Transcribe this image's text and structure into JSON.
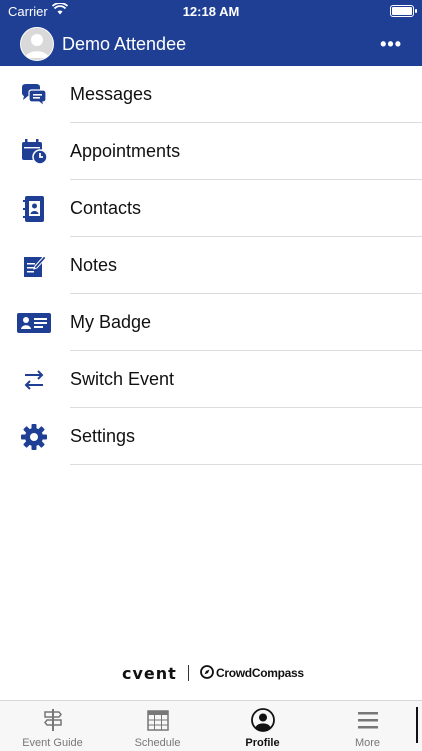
{
  "status_bar": {
    "carrier": "Carrier",
    "time": "12:18 AM"
  },
  "header": {
    "user_name": "Demo Attendee",
    "more_label": "•••"
  },
  "menu": [
    {
      "label": "Messages",
      "icon": "chat-icon"
    },
    {
      "label": "Appointments",
      "icon": "calendar-clock-icon"
    },
    {
      "label": "Contacts",
      "icon": "contact-book-icon"
    },
    {
      "label": "Notes",
      "icon": "note-edit-icon"
    },
    {
      "label": "My Badge",
      "icon": "badge-icon"
    },
    {
      "label": "Switch Event",
      "icon": "switch-arrows-icon"
    },
    {
      "label": "Settings",
      "icon": "gear-icon"
    }
  ],
  "brand": {
    "cvent": "cvent",
    "partner": "CrowdCompass"
  },
  "tabs": [
    {
      "label": "Event Guide",
      "icon": "signpost-icon",
      "active": false
    },
    {
      "label": "Schedule",
      "icon": "calendar-grid-icon",
      "active": false
    },
    {
      "label": "Profile",
      "icon": "profile-icon",
      "active": true
    },
    {
      "label": "More",
      "icon": "menu-icon",
      "active": false
    }
  ],
  "colors": {
    "primary": "#1f3f95",
    "tab_bar_bg": "#f7f7f7",
    "divider": "#dcdcdc"
  }
}
